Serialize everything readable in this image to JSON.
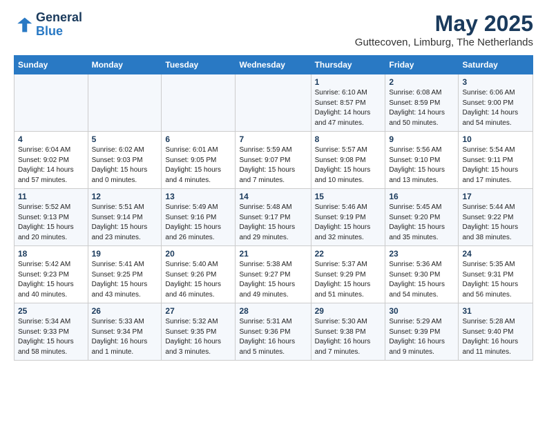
{
  "header": {
    "logo_line1": "General",
    "logo_line2": "Blue",
    "month_title": "May 2025",
    "location": "Guttecoven, Limburg, The Netherlands"
  },
  "weekdays": [
    "Sunday",
    "Monday",
    "Tuesday",
    "Wednesday",
    "Thursday",
    "Friday",
    "Saturday"
  ],
  "weeks": [
    [
      {
        "day": "",
        "info": ""
      },
      {
        "day": "",
        "info": ""
      },
      {
        "day": "",
        "info": ""
      },
      {
        "day": "",
        "info": ""
      },
      {
        "day": "1",
        "info": "Sunrise: 6:10 AM\nSunset: 8:57 PM\nDaylight: 14 hours\nand 47 minutes."
      },
      {
        "day": "2",
        "info": "Sunrise: 6:08 AM\nSunset: 8:59 PM\nDaylight: 14 hours\nand 50 minutes."
      },
      {
        "day": "3",
        "info": "Sunrise: 6:06 AM\nSunset: 9:00 PM\nDaylight: 14 hours\nand 54 minutes."
      }
    ],
    [
      {
        "day": "4",
        "info": "Sunrise: 6:04 AM\nSunset: 9:02 PM\nDaylight: 14 hours\nand 57 minutes."
      },
      {
        "day": "5",
        "info": "Sunrise: 6:02 AM\nSunset: 9:03 PM\nDaylight: 15 hours\nand 0 minutes."
      },
      {
        "day": "6",
        "info": "Sunrise: 6:01 AM\nSunset: 9:05 PM\nDaylight: 15 hours\nand 4 minutes."
      },
      {
        "day": "7",
        "info": "Sunrise: 5:59 AM\nSunset: 9:07 PM\nDaylight: 15 hours\nand 7 minutes."
      },
      {
        "day": "8",
        "info": "Sunrise: 5:57 AM\nSunset: 9:08 PM\nDaylight: 15 hours\nand 10 minutes."
      },
      {
        "day": "9",
        "info": "Sunrise: 5:56 AM\nSunset: 9:10 PM\nDaylight: 15 hours\nand 13 minutes."
      },
      {
        "day": "10",
        "info": "Sunrise: 5:54 AM\nSunset: 9:11 PM\nDaylight: 15 hours\nand 17 minutes."
      }
    ],
    [
      {
        "day": "11",
        "info": "Sunrise: 5:52 AM\nSunset: 9:13 PM\nDaylight: 15 hours\nand 20 minutes."
      },
      {
        "day": "12",
        "info": "Sunrise: 5:51 AM\nSunset: 9:14 PM\nDaylight: 15 hours\nand 23 minutes."
      },
      {
        "day": "13",
        "info": "Sunrise: 5:49 AM\nSunset: 9:16 PM\nDaylight: 15 hours\nand 26 minutes."
      },
      {
        "day": "14",
        "info": "Sunrise: 5:48 AM\nSunset: 9:17 PM\nDaylight: 15 hours\nand 29 minutes."
      },
      {
        "day": "15",
        "info": "Sunrise: 5:46 AM\nSunset: 9:19 PM\nDaylight: 15 hours\nand 32 minutes."
      },
      {
        "day": "16",
        "info": "Sunrise: 5:45 AM\nSunset: 9:20 PM\nDaylight: 15 hours\nand 35 minutes."
      },
      {
        "day": "17",
        "info": "Sunrise: 5:44 AM\nSunset: 9:22 PM\nDaylight: 15 hours\nand 38 minutes."
      }
    ],
    [
      {
        "day": "18",
        "info": "Sunrise: 5:42 AM\nSunset: 9:23 PM\nDaylight: 15 hours\nand 40 minutes."
      },
      {
        "day": "19",
        "info": "Sunrise: 5:41 AM\nSunset: 9:25 PM\nDaylight: 15 hours\nand 43 minutes."
      },
      {
        "day": "20",
        "info": "Sunrise: 5:40 AM\nSunset: 9:26 PM\nDaylight: 15 hours\nand 46 minutes."
      },
      {
        "day": "21",
        "info": "Sunrise: 5:38 AM\nSunset: 9:27 PM\nDaylight: 15 hours\nand 49 minutes."
      },
      {
        "day": "22",
        "info": "Sunrise: 5:37 AM\nSunset: 9:29 PM\nDaylight: 15 hours\nand 51 minutes."
      },
      {
        "day": "23",
        "info": "Sunrise: 5:36 AM\nSunset: 9:30 PM\nDaylight: 15 hours\nand 54 minutes."
      },
      {
        "day": "24",
        "info": "Sunrise: 5:35 AM\nSunset: 9:31 PM\nDaylight: 15 hours\nand 56 minutes."
      }
    ],
    [
      {
        "day": "25",
        "info": "Sunrise: 5:34 AM\nSunset: 9:33 PM\nDaylight: 15 hours\nand 58 minutes."
      },
      {
        "day": "26",
        "info": "Sunrise: 5:33 AM\nSunset: 9:34 PM\nDaylight: 16 hours\nand 1 minute."
      },
      {
        "day": "27",
        "info": "Sunrise: 5:32 AM\nSunset: 9:35 PM\nDaylight: 16 hours\nand 3 minutes."
      },
      {
        "day": "28",
        "info": "Sunrise: 5:31 AM\nSunset: 9:36 PM\nDaylight: 16 hours\nand 5 minutes."
      },
      {
        "day": "29",
        "info": "Sunrise: 5:30 AM\nSunset: 9:38 PM\nDaylight: 16 hours\nand 7 minutes."
      },
      {
        "day": "30",
        "info": "Sunrise: 5:29 AM\nSunset: 9:39 PM\nDaylight: 16 hours\nand 9 minutes."
      },
      {
        "day": "31",
        "info": "Sunrise: 5:28 AM\nSunset: 9:40 PM\nDaylight: 16 hours\nand 11 minutes."
      }
    ]
  ]
}
